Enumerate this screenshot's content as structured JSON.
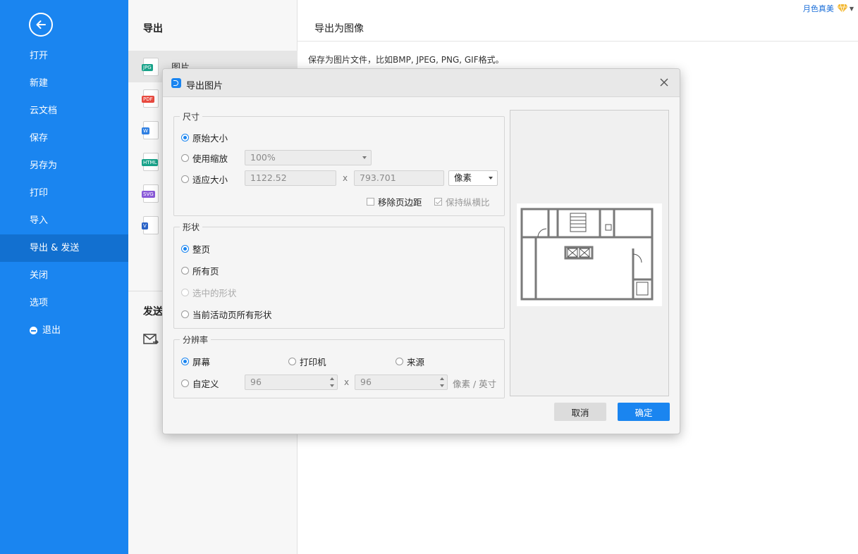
{
  "sidebar": {
    "items": [
      {
        "label": "打开"
      },
      {
        "label": "新建"
      },
      {
        "label": "云文档"
      },
      {
        "label": "保存"
      },
      {
        "label": "另存为"
      },
      {
        "label": "打印"
      },
      {
        "label": "导入"
      },
      {
        "label": "导出 & 发送"
      },
      {
        "label": "关闭"
      },
      {
        "label": "选项"
      },
      {
        "label": "退出"
      }
    ]
  },
  "middle": {
    "title": "导出",
    "items": [
      {
        "label": "图片",
        "tag": "JPG",
        "color": "#19a38a"
      },
      {
        "label": "",
        "tag": "PDF",
        "color": "#e8493f"
      },
      {
        "label": "",
        "tag": "W",
        "color": "#2f7fe2"
      },
      {
        "label": "",
        "tag": "HTML",
        "color": "#19a38a"
      },
      {
        "label": "",
        "tag": "SVG",
        "color": "#8a5ad8"
      },
      {
        "label": "",
        "tag": "V",
        "color": "#2a63c7"
      }
    ],
    "send_title": "发送"
  },
  "content": {
    "title": "导出为图像",
    "description": "保存为图片文件，比如BMP, JPEG, PNG, GIF格式。",
    "user_name": "月色真美"
  },
  "dialog": {
    "title": "导出图片",
    "size": {
      "legend": "尺寸",
      "original": "原始大小",
      "use_zoom": "使用缩放",
      "zoom_value": "100%",
      "fit_size": "适应大小",
      "width": "1122.52",
      "height": "793.701",
      "x": "x",
      "unit": "像素",
      "remove_margin": "移除页边距",
      "keep_ratio": "保持纵横比"
    },
    "shape": {
      "legend": "形状",
      "whole_page": "整页",
      "all_pages": "所有页",
      "selected": "选中的形状",
      "current_page_all": "当前活动页所有形状"
    },
    "resolution": {
      "legend": "分辨率",
      "screen": "屏幕",
      "printer": "打印机",
      "source": "来源",
      "custom": "自定义",
      "dpi_x": "96",
      "dpi_y": "96",
      "x": "x",
      "unit": "像素 / 英寸"
    },
    "cancel": "取消",
    "ok": "确定"
  }
}
